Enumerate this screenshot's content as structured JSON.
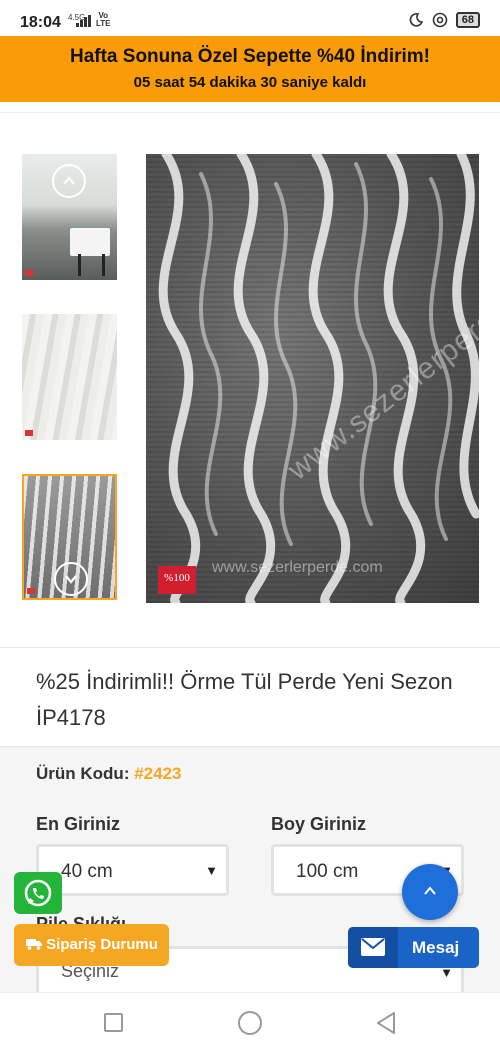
{
  "status_bar": {
    "time": "18:04",
    "network": "4.5G",
    "volte_top": "Vo",
    "volte_bottom": "LTE",
    "battery": "68"
  },
  "promo": {
    "title": "Hafta Sonuna Özel Sepette %40 İndirim!",
    "countdown": "05 saat 54 dakika 30 saniye kaldı"
  },
  "gallery": {
    "main_watermark": "www.sezerlerperde.com",
    "main_watermark_bottom": "www.sezerlerperde.com",
    "brand_badge": "%100"
  },
  "product": {
    "title": "%25 İndirimli!! Örme Tül Perde Yeni Sezon İP4178",
    "code_label": "Ürün Kodu:",
    "code_value": "#2423"
  },
  "options": {
    "width_label": "En Giriniz",
    "width_value": "40 cm",
    "height_label": "Boy Giriniz",
    "height_value": "100 cm",
    "pleat_label": "Pile Sıklığı",
    "pleat_value": "Seçiniz"
  },
  "floating": {
    "order_status_label": "Sipariş Durumu",
    "message_label": "Mesaj"
  },
  "colors": {
    "accent_orange": "#f99c07",
    "code_orange": "#f5a623",
    "whatsapp_green": "#25b43a",
    "primary_blue": "#1e6fd9"
  }
}
